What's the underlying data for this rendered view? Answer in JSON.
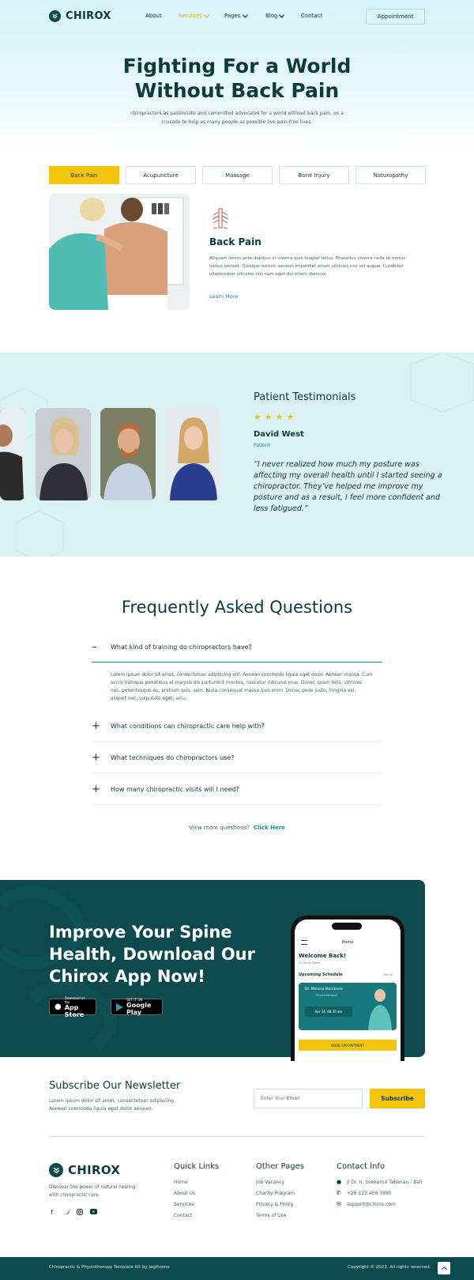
{
  "header": {
    "logo": "CHIROX",
    "nav": [
      "About",
      "Services",
      "Pages",
      "Blog",
      "Contact"
    ],
    "appointment": "Appointment"
  },
  "hero": {
    "title_line1": "Fighting For a World",
    "title_line2": "Without Back Pain",
    "subtitle": "chiropractors as passionate and committed advocates for a world without back pain, on a crusade to help as many people as possible live pain-free lives."
  },
  "services": {
    "tabs": [
      "Back Pain",
      "Acupuncture",
      "Massage",
      "Bone Injury",
      "Naturopathy"
    ],
    "title": "Back Pain",
    "text": "Aliquam lorem ante dapibus in viverra quis feugiat tellus. Phasellus viverra nulla ut metus varius laoreet. Quisque rutrum aenean imperdiet etiam ultricies nisi vel augue. Curabitur ullamcorper ultricies nisi nam eget dui etiam rhoncus.",
    "link": "Learn More"
  },
  "testimonials": {
    "title": "Patient Testimonials",
    "rating": 4,
    "name": "David West",
    "role": "Patient",
    "quote": "“I never realized how much my posture was affecting my overall health until I started seeing a chiropractor. They’ve helped me improve my posture and as a result, I feel more confident and less fatigued.”"
  },
  "faq": {
    "title": "Frequently Asked Questions",
    "questions": [
      "What kind of training do chiropractors have?",
      "What conditions can chiropractic care help with?",
      "What techniques do chiropractors use?",
      "How many chiropractic visits will I need?"
    ],
    "answer": "Lorem ipsum dolor sit amet, consectetuer adipiscing elit. Aenean commodo ligula eget dolor. Aenean massa. Cum sociis natoque penatibus et magnis dis parturient montes, nascetur ridiculus mus. Donec quam felis, ultricies nec, pellentesque eu, pretium quis, sem. Nulla consequat massa quis enim. Donec pede justo, fringilla vel, aliquet nec, vulputate eget, arcu.",
    "more_text": "View more questions?",
    "more_link": "Click Here"
  },
  "app": {
    "title": "Improve Your Spine Health, Download Our Chirox App Now!",
    "appstore_small": "Download on the",
    "appstore_large": "App Store",
    "googleplay_small": "GET IT ON",
    "googleplay_large": "Google Play",
    "phone": {
      "header": "Home",
      "welcome": "Welcome Back!",
      "user": "Hi, Jessie Frazer",
      "upcoming": "Upcoming Schedule",
      "see_all": "See All",
      "doctor": "Dr. Melissa Mondover",
      "specialty": "Physiotherapist",
      "date": "Apr 14, 08.30 am",
      "book": "BOOK APPOINTMENT"
    }
  },
  "newsletter": {
    "title": "Subscribe Our Newsletter",
    "text": "Lorem ipsum dolor sit amet, consectetuer adipiscing. Aenean commodo ligula eget dolor aenean.",
    "placeholder": "Enter Your Email",
    "button": "Subscribe"
  },
  "footer": {
    "logo": "CHIROX",
    "desc": "Discover the power of natural healing with chiropractic care.",
    "quick_title": "Quick Links",
    "quick_links": [
      "Home",
      "About Us",
      "Services",
      "Contact"
    ],
    "other_title": "Other Pages",
    "other_links": [
      "Job Vacancy",
      "Charity Program",
      "Privacy & Policy",
      "Terms of Use"
    ],
    "contact_title": "Contact Info",
    "address": "Jl Dr. Ir. Soekarno Tabanan - Bali",
    "phone": "+26 123 456 7890",
    "email": "support@chirox.com",
    "credit": "Chiropractic & Physiotherapy Template Kit by Jegtheme",
    "copyright": "Copyright © 2023. All rights reserved."
  },
  "colors": {
    "primary": "#0c4a4d",
    "accent": "#f2c40c",
    "teal": "#0f8f9b"
  }
}
